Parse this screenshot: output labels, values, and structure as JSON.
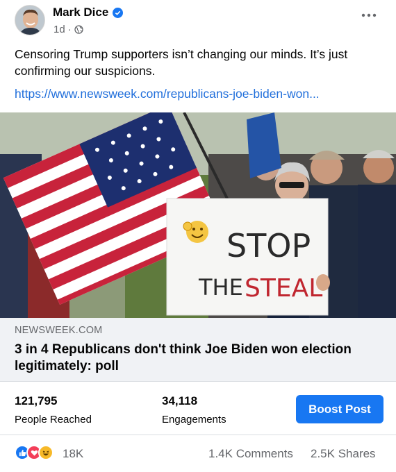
{
  "post": {
    "author": "Mark Dice",
    "time": "1d",
    "separator": "·",
    "text": "Censoring Trump supporters isn’t changing our minds.  It’s just confirming our suspicions.",
    "link": "https://www.newsweek.com/republicans-joe-biden-won..."
  },
  "image": {
    "sign_line1": "STOP",
    "sign_line2": "THE",
    "sign_line3": "STEAL"
  },
  "preview": {
    "domain": "NEWSWEEK.COM",
    "headline": "3 in 4 Republicans don't think Joe Biden won election legitimately: poll"
  },
  "stats": {
    "reached_value": "121,795",
    "reached_label": "People Reached",
    "engagements_value": "34,118",
    "engagements_label": "Engagements",
    "boost_label": "Boost Post"
  },
  "reactions": {
    "count": "18K",
    "comments": "1.4K Comments",
    "shares": "2.5K Shares",
    "icons": [
      "like-icon",
      "love-icon",
      "haha-icon"
    ]
  },
  "colors": {
    "accent": "#1877f2",
    "link": "#216fdb",
    "muted": "#65676b",
    "preview_bg": "#f0f2f5"
  }
}
